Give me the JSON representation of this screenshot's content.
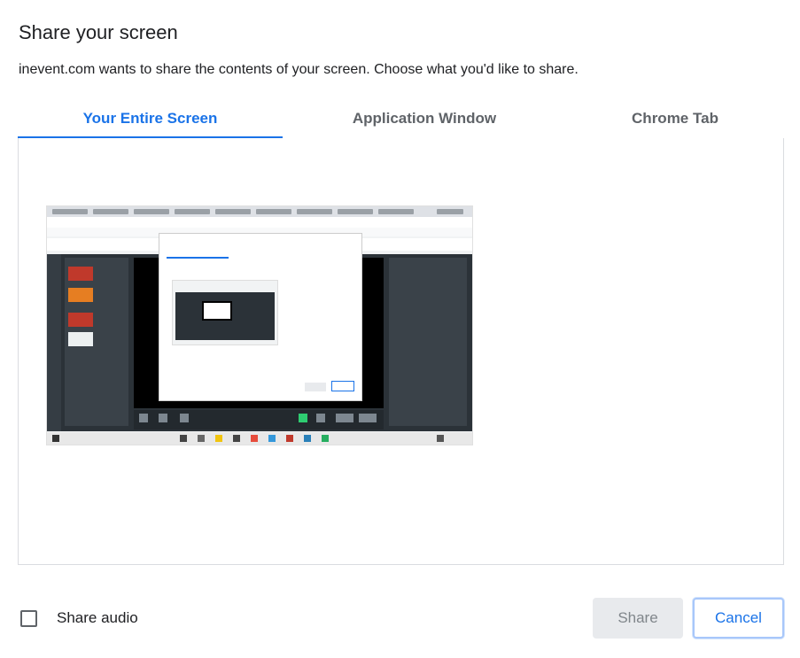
{
  "dialog": {
    "title": "Share your screen",
    "subtitle": "inevent.com wants to share the contents of your screen. Choose what you'd like to share."
  },
  "tabs": [
    {
      "label": "Your Entire Screen",
      "active": true
    },
    {
      "label": "Application Window",
      "active": false
    },
    {
      "label": "Chrome Tab",
      "active": false
    }
  ],
  "footer": {
    "share_audio_label": "Share audio",
    "share_audio_checked": false,
    "share_button": "Share",
    "cancel_button": "Cancel"
  },
  "colors": {
    "accent": "#1a73e8",
    "tab_inactive": "#5f6368",
    "disabled_button_bg": "#e8eaed"
  }
}
